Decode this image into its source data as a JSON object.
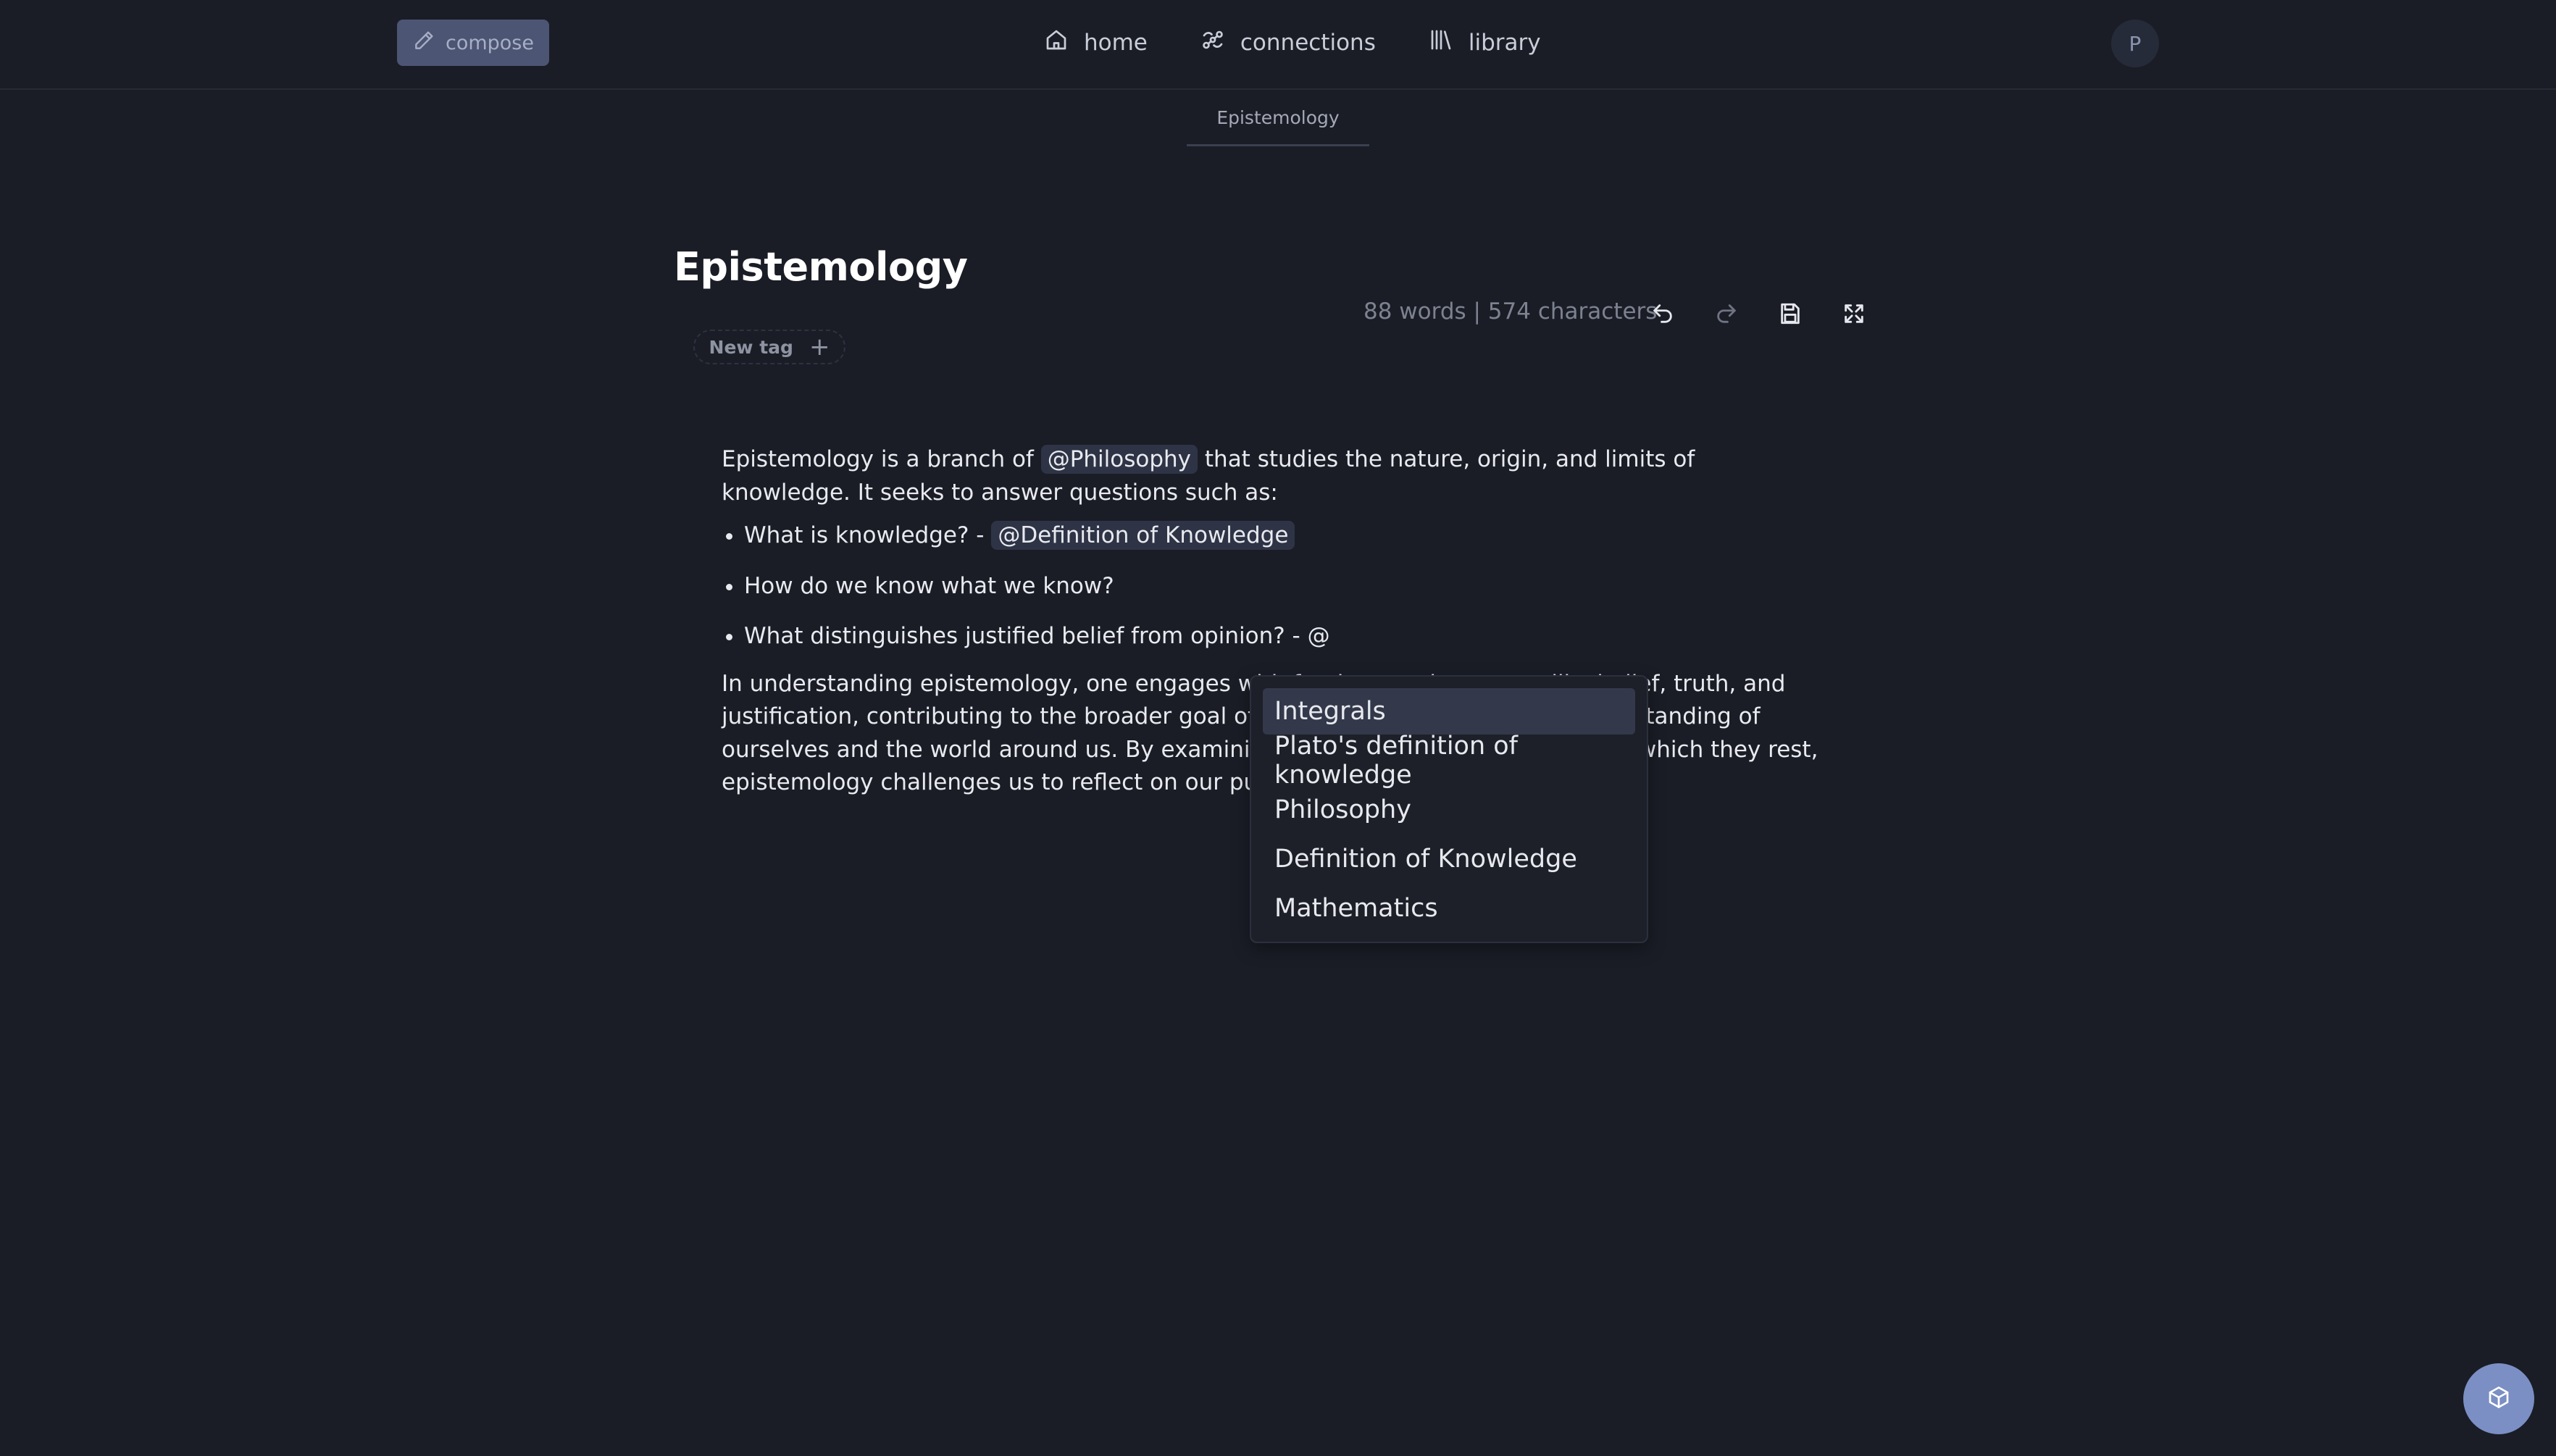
{
  "topbar": {
    "compose_label": "compose",
    "nav": [
      {
        "label": "home",
        "icon": "home-icon"
      },
      {
        "label": "connections",
        "icon": "connections-icon"
      },
      {
        "label": "library",
        "icon": "library-icon"
      }
    ],
    "avatar_initial": "P"
  },
  "tab": {
    "label": "Epistemology"
  },
  "editor": {
    "title": "Epistemology",
    "new_tag_label": "New tag",
    "stats": "88 words | 574 characters"
  },
  "content": {
    "p1_before": "Epistemology is a branch of ",
    "p1_mention": "@Philosophy",
    "p1_after": " that studies the nature, origin, and limits of knowledge. It seeks to answer questions such as:",
    "bullets": [
      {
        "text": "What is knowledge? - ",
        "mention": "@Definition of Knowledge"
      },
      {
        "text": "How do we know what we know?"
      },
      {
        "text": "What distinguishes justified belief from opinion? - @"
      }
    ],
    "p2": "In understanding epistemology, one engages with fundamental concepts like belief, truth, and justification, contributing to the broader goal of philosophy: deepening our understanding of ourselves and the world around us. By examining our beliefs and the grounds on which they rest, epistemology challenges us to reflect on our pursuit of wisdom"
  },
  "suggestions": {
    "items": [
      "Integrals",
      "Plato's definition of knowledge",
      "Philosophy",
      "Definition of Knowledge",
      "Mathematics"
    ],
    "selected_index": 0
  },
  "colors": {
    "background": "#1a1d26",
    "compose_button": "#4c5573",
    "fab": "#7b8fc4",
    "mention_bg": "#2e3446"
  }
}
